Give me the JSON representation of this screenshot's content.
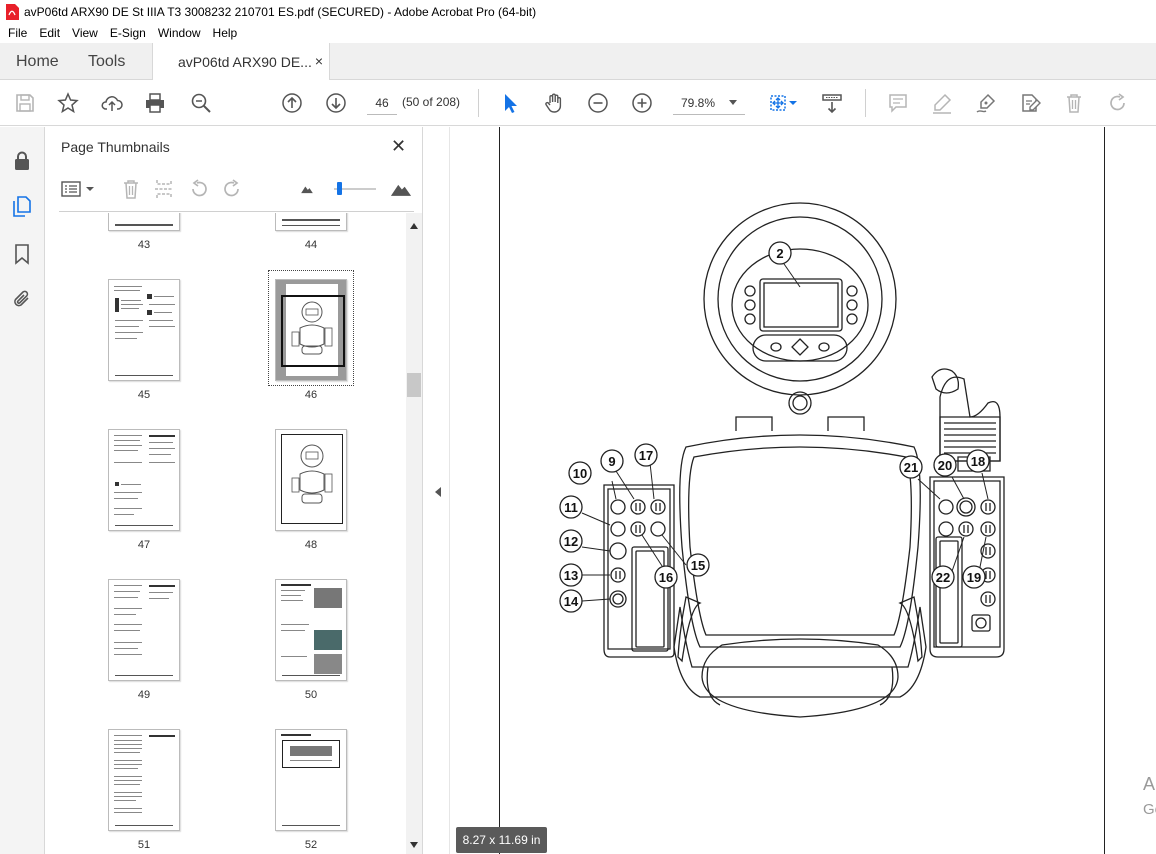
{
  "window": {
    "title": "avP06td ARX90 DE St IIIA T3 3008232 210701 ES.pdf (SECURED) - Adobe Acrobat Pro (64-bit)"
  },
  "menu": [
    "File",
    "Edit",
    "View",
    "E-Sign",
    "Window",
    "Help"
  ],
  "tabs": {
    "home": "Home",
    "tools": "Tools",
    "document": "avP06td ARX90 DE...",
    "close_symbol": "×"
  },
  "toolbar": {
    "page_number": "46",
    "page_count": "(50 of 208)",
    "zoom": "79.8%"
  },
  "panel": {
    "title": "Page Thumbnails",
    "close_symbol": "✕",
    "thumbnails": [
      {
        "label": "43"
      },
      {
        "label": "44"
      },
      {
        "label": "45"
      },
      {
        "label": "46",
        "selected": true
      },
      {
        "label": "47"
      },
      {
        "label": "48"
      },
      {
        "label": "49"
      },
      {
        "label": "50"
      },
      {
        "label": "51"
      },
      {
        "label": "52"
      }
    ]
  },
  "document": {
    "page_size": "8.27 x 11.69 in",
    "callouts": [
      "2",
      "9",
      "10",
      "11",
      "12",
      "13",
      "14",
      "15",
      "16",
      "17",
      "18",
      "19",
      "20",
      "21",
      "22"
    ]
  },
  "overlay": {
    "activate_text": "A",
    "activate_sub": "Go"
  },
  "colors": {
    "accent": "#1473e6",
    "toolbar_icon": "#555555",
    "disabled_icon": "#b5b5b5"
  },
  "icons": {
    "rail": [
      "lock-icon",
      "pages-icon",
      "bookmark-icon",
      "attachment-icon"
    ],
    "toolbar": [
      "save-icon",
      "star-icon",
      "upload-icon",
      "print-icon",
      "zoom-search-icon",
      "page-up-icon",
      "page-down-icon",
      "select-arrow-icon",
      "hand-icon",
      "zoom-out-icon",
      "zoom-in-icon",
      "fit-page-icon",
      "scroll-mode-icon",
      "comment-icon",
      "highlight-icon",
      "sign-icon",
      "edit-icon",
      "delete-icon",
      "redo-icon"
    ]
  }
}
